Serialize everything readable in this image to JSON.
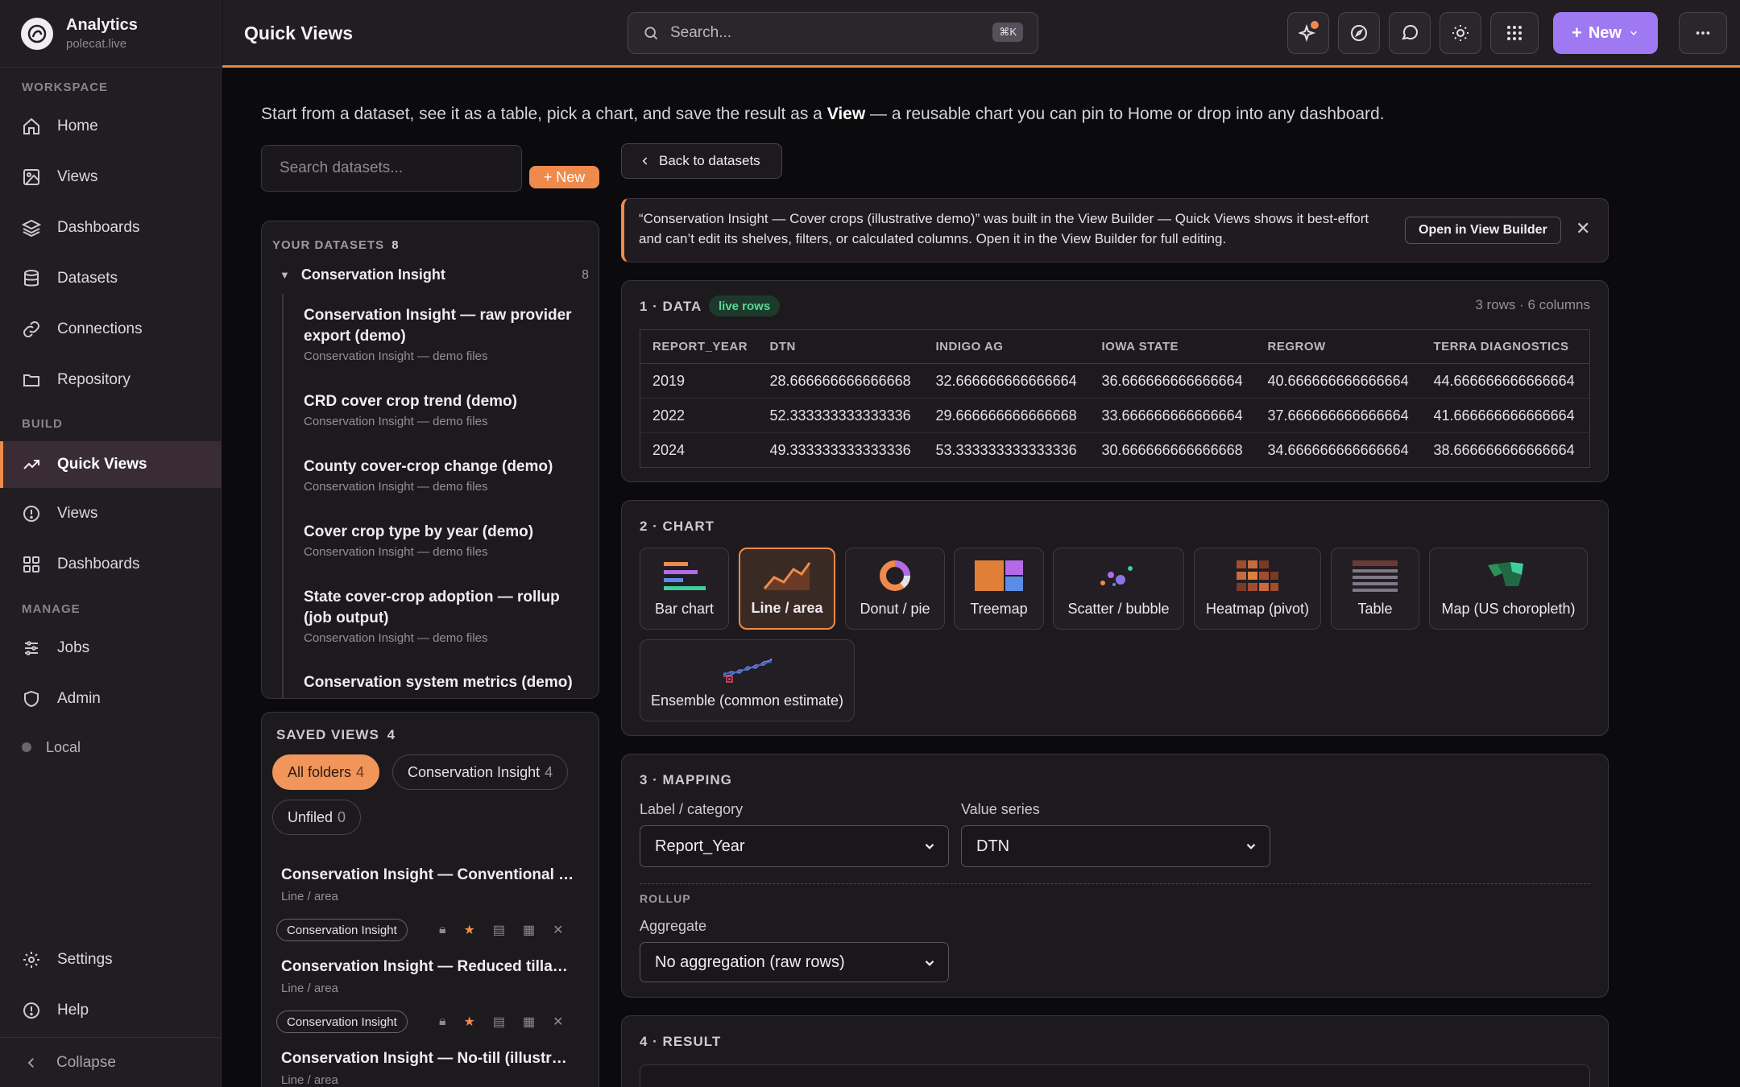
{
  "app": {
    "name": "Analytics",
    "domain": "polecat.live"
  },
  "sidebar": {
    "sections": {
      "workspace": "WORKSPACE",
      "build": "BUILD",
      "manage": "MANAGE"
    },
    "workspace_items": [
      {
        "label": "Home",
        "icon": "home-icon"
      },
      {
        "label": "Views",
        "icon": "image-icon"
      },
      {
        "label": "Dashboards",
        "icon": "layers-icon"
      },
      {
        "label": "Datasets",
        "icon": "database-icon"
      },
      {
        "label": "Connections",
        "icon": "link-icon"
      },
      {
        "label": "Repository",
        "icon": "folder-icon"
      }
    ],
    "build_items": [
      {
        "label": "Quick Views",
        "icon": "trend-icon",
        "active": true
      },
      {
        "label": "Views",
        "icon": "info-circle-icon"
      },
      {
        "label": "Dashboards",
        "icon": "grid-icon"
      }
    ],
    "manage_items": [
      {
        "label": "Jobs",
        "icon": "sliders-icon"
      },
      {
        "label": "Admin",
        "icon": "shield-icon"
      }
    ],
    "env": "Local",
    "bottom": [
      {
        "label": "Settings",
        "icon": "gear-icon"
      },
      {
        "label": "Help",
        "icon": "help-icon"
      }
    ],
    "collapse": "Collapse"
  },
  "topbar": {
    "title": "Quick Views",
    "search_placeholder": "Search...",
    "shortcut": "⌘K",
    "new_label": "New"
  },
  "intro": {
    "before": "Start from a dataset, see it as a table, pick a chart, and save the result as a ",
    "bold": "View",
    "after": " — a reusable chart you can pin to Home or drop into any dashboard."
  },
  "datasets": {
    "search_placeholder": "Search datasets...",
    "new_label": "+ New",
    "header": "YOUR DATASETS",
    "count": "8",
    "group": {
      "name": "Conservation Insight",
      "count": "8"
    },
    "items": [
      {
        "title": "Conservation Insight — raw provider export (demo)",
        "sub": "Conservation Insight — demo files"
      },
      {
        "title": "CRD cover crop trend (demo)",
        "sub": "Conservation Insight — demo files"
      },
      {
        "title": "County cover-crop change (demo)",
        "sub": "Conservation Insight — demo files"
      },
      {
        "title": "Cover crop type by year (demo)",
        "sub": "Conservation Insight — demo files"
      },
      {
        "title": "State cover-crop adoption — rollup (job output)",
        "sub": "Conservation Insight — demo files"
      },
      {
        "title": "Conservation system metrics (demo)",
        "sub": ""
      }
    ]
  },
  "saved_views": {
    "header": "SAVED VIEWS",
    "count": "4",
    "filters": [
      {
        "label": "All folders",
        "n": "4"
      },
      {
        "label": "Conservation Insight",
        "n": "4"
      },
      {
        "label": "Unfiled",
        "n": "0"
      }
    ],
    "items": [
      {
        "title": "Conservation Insight — Conventional (il...",
        "sub": "Line / area",
        "tag": "Conservation Insight"
      },
      {
        "title": "Conservation Insight — Reduced tillage ...",
        "sub": "Line / area",
        "tag": "Conservation Insight"
      },
      {
        "title": "Conservation Insight — No-till (illustrati...",
        "sub": "Line / area",
        "tag": ""
      }
    ]
  },
  "main": {
    "back_label": "Back to datasets",
    "notice": "“Conservation Insight — Cover crops (illustrative demo)” was built in the View Builder — Quick Views shows it best-effort and can’t edit its shelves, filters, or calculated columns. Open it in the View Builder for full editing.",
    "notice_button": "Open in View Builder",
    "data": {
      "title": "1 · DATA",
      "badge": "live rows",
      "meta": "3 rows · 6 columns",
      "columns": [
        "REPORT_YEAR",
        "DTN",
        "INDIGO AG",
        "IOWA STATE",
        "REGROW",
        "TERRA DIAGNOSTICS"
      ],
      "rows": [
        [
          "2019",
          "28.666666666666668",
          "32.666666666666664",
          "36.666666666666664",
          "40.666666666666664",
          "44.666666666666664"
        ],
        [
          "2022",
          "52.333333333333336",
          "29.666666666666668",
          "33.666666666666664",
          "37.666666666666664",
          "41.666666666666664"
        ],
        [
          "2024",
          "49.333333333333336",
          "53.333333333333336",
          "30.666666666666668",
          "34.666666666666664",
          "38.666666666666664"
        ]
      ]
    },
    "chart": {
      "title": "2 · CHART",
      "types": [
        "Bar chart",
        "Line / area",
        "Donut / pie",
        "Treemap",
        "Scatter / bubble",
        "Heatmap (pivot)",
        "Table",
        "Map (US choropleth)",
        "Ensemble (common estimate)"
      ],
      "selected": "Line / area"
    },
    "mapping": {
      "title": "3 · MAPPING",
      "label_field": "Label / category",
      "label_value": "Report_Year",
      "value_field": "Value series",
      "value_value": "DTN",
      "rollup": "ROLLUP",
      "aggregate_label": "Aggregate",
      "aggregate_value": "No aggregation (raw rows)"
    },
    "result": {
      "title": "4 · RESULT"
    }
  },
  "colors": {
    "accent": "#f08a4b",
    "primary": "#9f79f2",
    "live": "#5fd59a"
  }
}
